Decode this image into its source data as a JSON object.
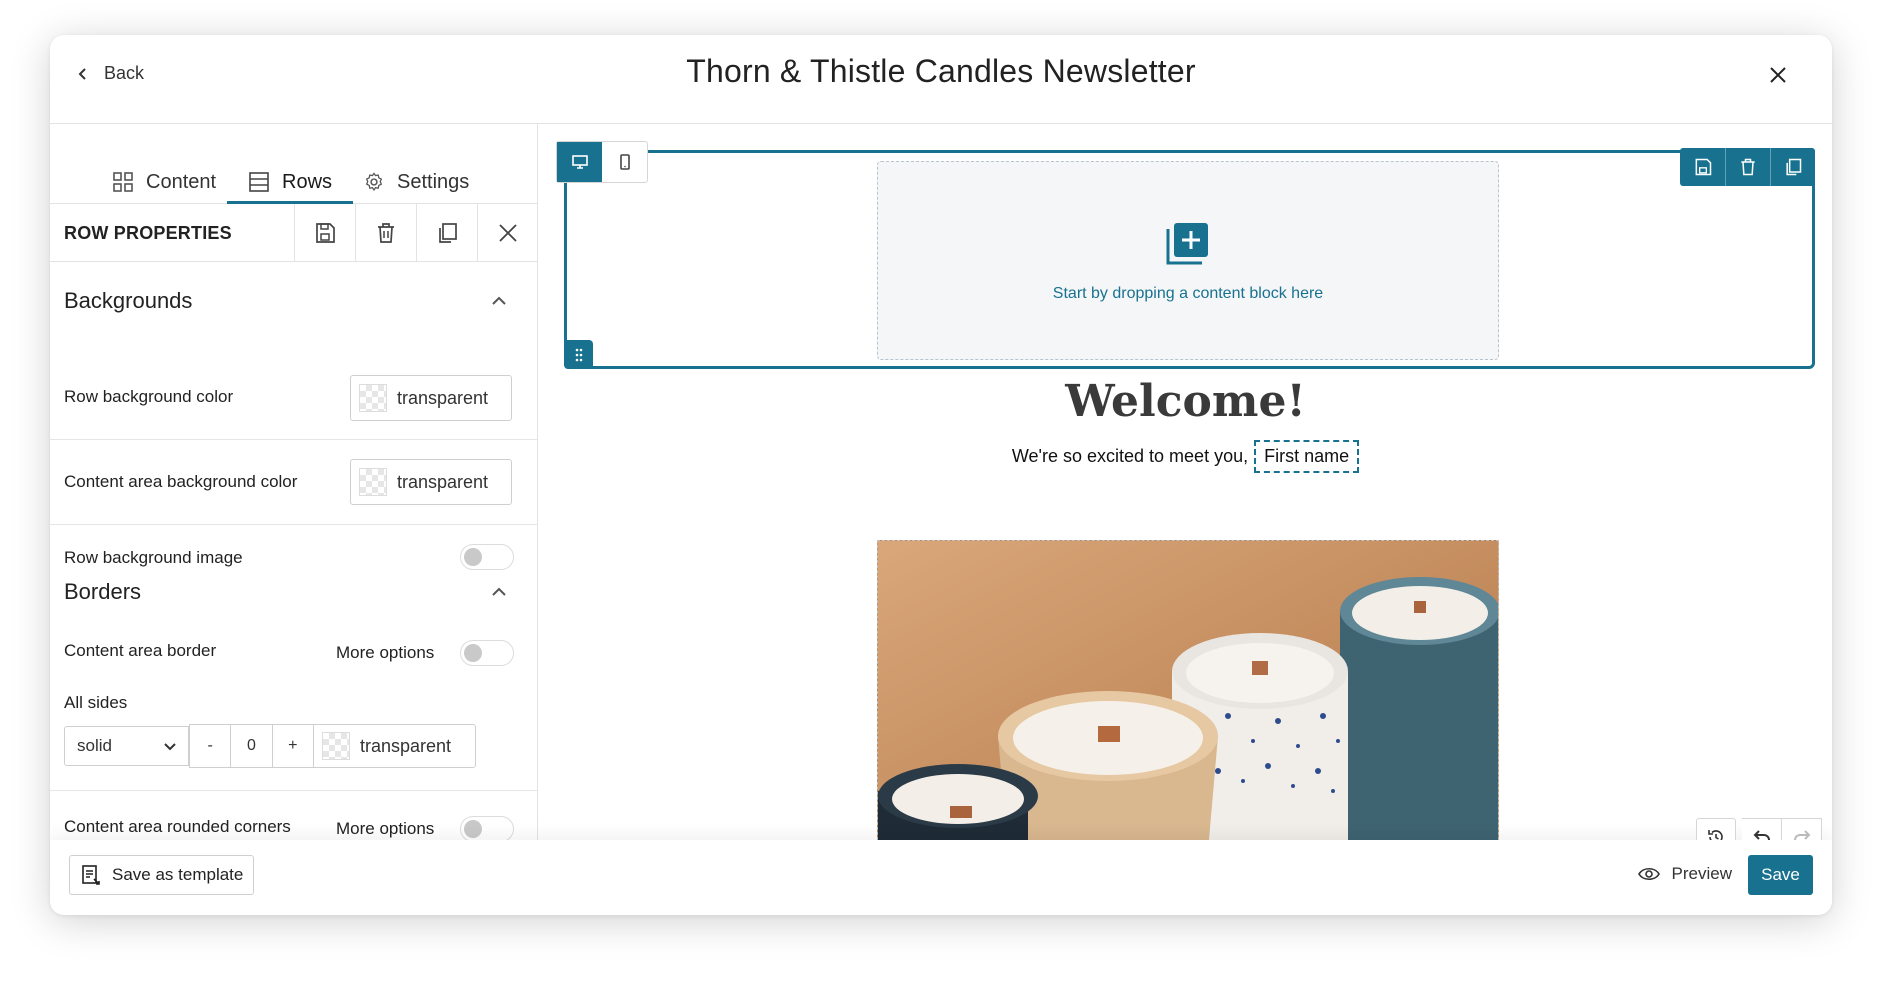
{
  "header": {
    "back_label": "Back",
    "title": "Thorn & Thistle Candles Newsletter"
  },
  "tabs": [
    {
      "label": "Content",
      "icon": "grid-icon"
    },
    {
      "label": "Rows",
      "icon": "rows-icon",
      "active": true
    },
    {
      "label": "Settings",
      "icon": "gear-icon"
    }
  ],
  "row_properties": {
    "title": "ROW PROPERTIES"
  },
  "backgrounds": {
    "heading": "Backgrounds",
    "row_bg_label": "Row background color",
    "row_bg_value": "transparent",
    "content_bg_label": "Content area background color",
    "content_bg_value": "transparent",
    "row_bg_image_label": "Row background image"
  },
  "borders": {
    "heading": "Borders",
    "content_border_label": "Content area border",
    "more_options": "More options",
    "all_sides_label": "All sides",
    "style_value": "solid",
    "minus": "-",
    "width_value": "0",
    "plus": "+",
    "color_value": "transparent",
    "rounded_label": "Content area rounded corners",
    "rounded_more_options": "More options"
  },
  "canvas": {
    "drop_text": "Start by dropping a content block here",
    "welcome": "Welcome!",
    "greeting": "We're so excited to meet you,",
    "merge_tag": "First name"
  },
  "footer": {
    "save_template": "Save as template",
    "preview": "Preview",
    "save": "Save"
  },
  "colors": {
    "accent": "#18728f"
  }
}
